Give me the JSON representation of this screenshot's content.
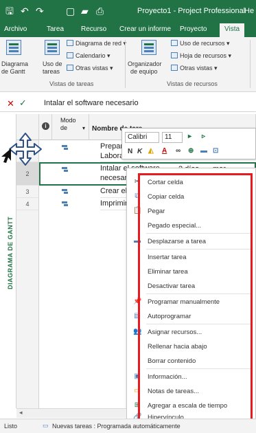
{
  "titlebar": {
    "quick_access": [
      "save-icon",
      "undo-icon",
      "redo-icon",
      "new-icon",
      "open-icon",
      "print-preview-icon"
    ],
    "title": "Proyecto1 - Project Professional",
    "right_fragment": "He"
  },
  "tabs": [
    {
      "label": "Archivo"
    },
    {
      "label": "Tarea"
    },
    {
      "label": "Recurso"
    },
    {
      "label": "Crear un informe"
    },
    {
      "label": "Proyecto"
    },
    {
      "label": "Vista",
      "active": true
    }
  ],
  "ribbon": {
    "group_tasks": {
      "label": "Vistas de tareas",
      "gantt_line1": "Diagrama",
      "gantt_line2": "de Gantt",
      "usage_line1": "Uso de",
      "usage_line2": "tareas",
      "network": "Diagrama de red",
      "calendar": "Calendario",
      "other_views": "Otras vistas"
    },
    "group_resources": {
      "label": "Vistas de recursos",
      "organizer_line1": "Organizador",
      "organizer_line2": "de equipo",
      "usage": "Uso de recursos",
      "sheet": "Hoja de recursos",
      "other_views": "Otras vistas"
    }
  },
  "entrybar": {
    "cancel": "✕",
    "accept": "✓",
    "value": "Intalar el software necesario"
  },
  "sidebar": {
    "label": "DIAGRAMA DE GANTT"
  },
  "grid": {
    "headers": {
      "mode": "Modo de",
      "name": "Nombre de tare"
    },
    "rows": [
      {
        "num": "1",
        "name_line1": "Preparar el",
        "name_line2": "Laboratorio"
      },
      {
        "num": "2",
        "name_line1": "Intalar el software",
        "name_line2": "necesario",
        "duration": "2 días",
        "start": "mar"
      },
      {
        "num": "3",
        "name_line1": "Crear el aula"
      },
      {
        "num": "4",
        "name_line1": "Imprimir el"
      }
    ]
  },
  "minitoolbar": {
    "font": "Calibri",
    "size": "11",
    "bold": "N",
    "italic": "K"
  },
  "context_menu": [
    {
      "icon": "scissors-icon",
      "glyph": "✂",
      "label": "Cortar celda"
    },
    {
      "icon": "copy-icon",
      "glyph": "⧉",
      "label": "Copiar celda"
    },
    {
      "icon": "paste-icon",
      "glyph": "📋",
      "label": "Pegar"
    },
    {
      "icon": "none",
      "glyph": "",
      "label": "Pegado especial..."
    },
    {
      "icon": "scroll-to-task-icon",
      "glyph": "▬",
      "label": "Desplazarse a tarea"
    },
    {
      "icon": "none",
      "glyph": "",
      "label": "Insertar tarea"
    },
    {
      "icon": "none",
      "glyph": "",
      "label": "Eliminar tarea"
    },
    {
      "icon": "none",
      "glyph": "",
      "label": "Desactivar tarea"
    },
    {
      "icon": "pushpin-icon",
      "glyph": "📌",
      "label": "Programar manualmente"
    },
    {
      "icon": "autoschedule-icon",
      "glyph": "▤",
      "label": "Autoprogramar"
    },
    {
      "icon": "assign-resources-icon",
      "glyph": "👥",
      "label": "Asignar recursos..."
    },
    {
      "icon": "none",
      "glyph": "",
      "label": "Rellenar hacia abajo"
    },
    {
      "icon": "none",
      "glyph": "",
      "label": "Borrar contenido"
    },
    {
      "icon": "information-icon",
      "glyph": "▣",
      "label": "Información..."
    },
    {
      "icon": "task-notes-icon",
      "glyph": "▭",
      "label": "Notas de tareas..."
    },
    {
      "icon": "add-to-timeline-icon",
      "glyph": "⊞",
      "label": "Agregar a escala de tiempo"
    },
    {
      "icon": "hyperlink-icon",
      "glyph": "🔗",
      "label": "Hipervínculo..."
    }
  ],
  "statusbar": {
    "ready": "Listo",
    "new_tasks": "Nuevas tareas : Programada automáticamente"
  },
  "colors": {
    "accent": "#217346",
    "highlight_border": "#e8191f",
    "icon_blue": "#4a7fb8"
  }
}
